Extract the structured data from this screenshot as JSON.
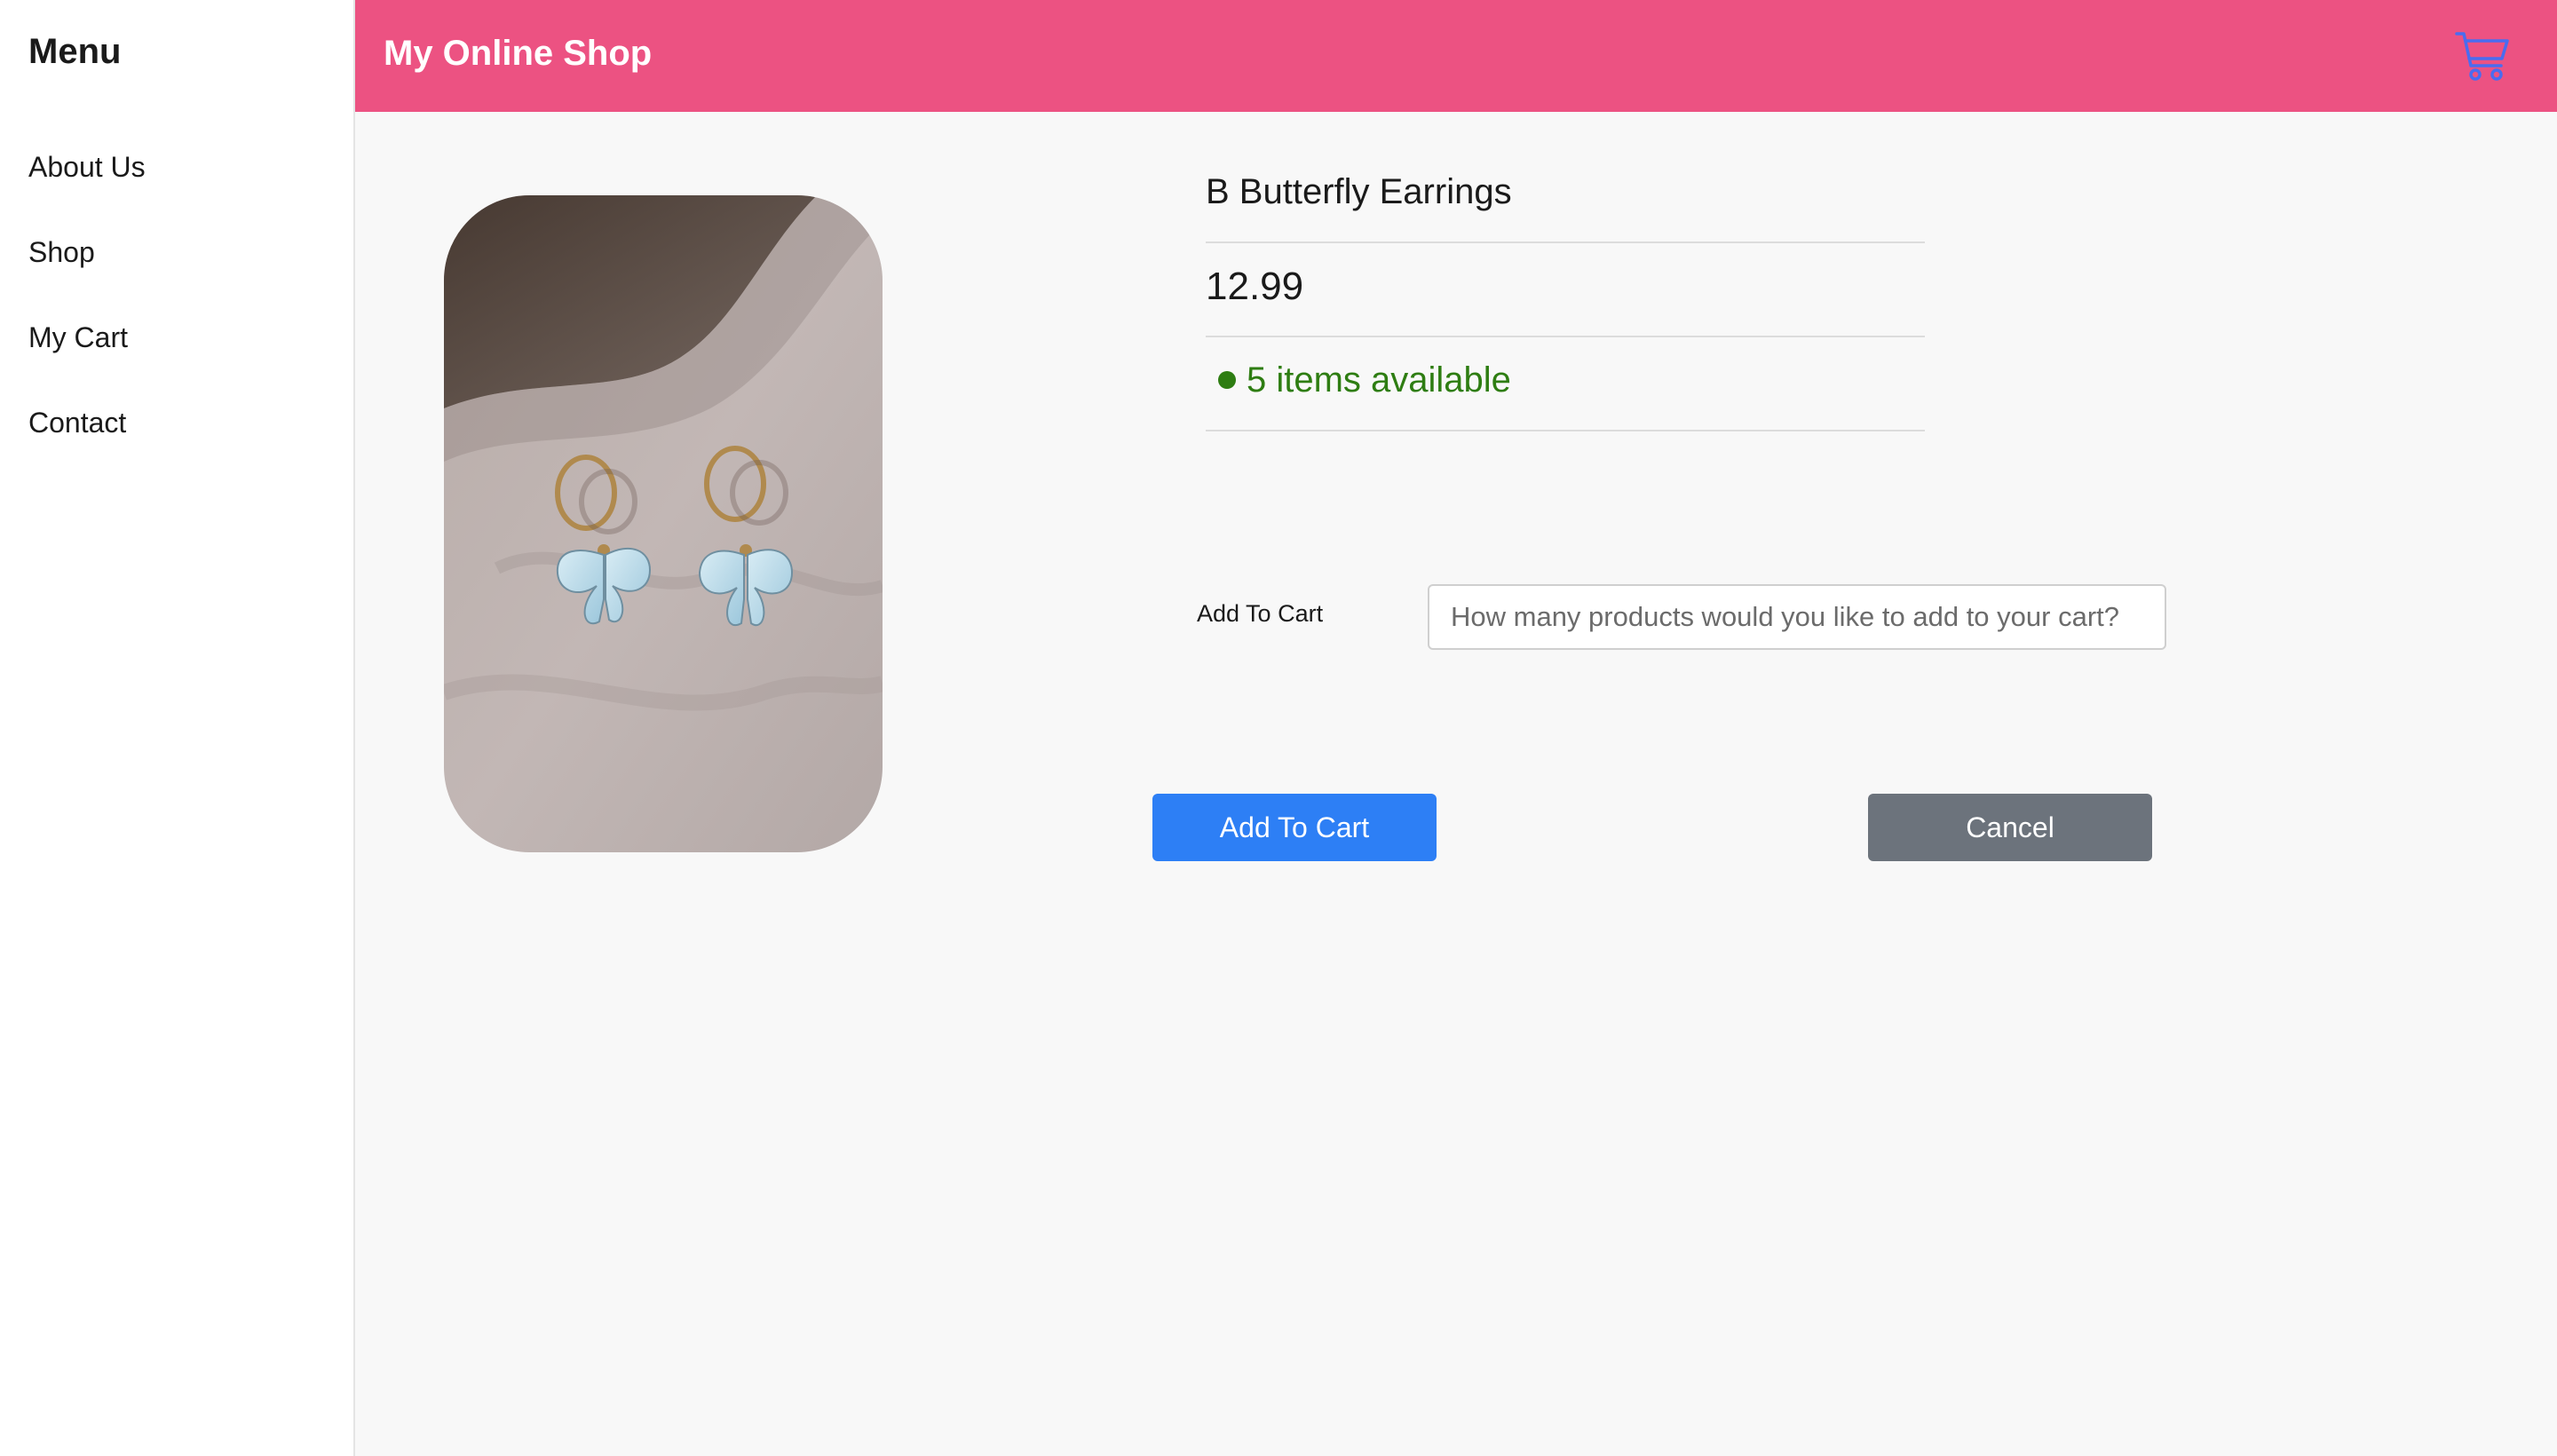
{
  "sidebar": {
    "title": "Menu",
    "items": [
      {
        "label": "About Us"
      },
      {
        "label": "Shop"
      },
      {
        "label": "My Cart"
      },
      {
        "label": "Contact"
      }
    ]
  },
  "header": {
    "title": "My Online Shop",
    "background_color": "#ec5282",
    "cart_icon": "shopping-cart-icon",
    "cart_icon_color": "#4a6cf0"
  },
  "product": {
    "name": "B Butterfly Earrings",
    "price": "12.99",
    "stock_text": "5 items available",
    "stock_color": "#2e7d12",
    "image": "butterfly-earrings-photo"
  },
  "form": {
    "quantity_label": "Add To Cart",
    "quantity_placeholder": "How many products would you like to add to your cart?",
    "quantity_value": ""
  },
  "actions": {
    "add_label": "Add To Cart",
    "add_color": "#2d7ff5",
    "cancel_label": "Cancel",
    "cancel_color": "#6c737c"
  }
}
